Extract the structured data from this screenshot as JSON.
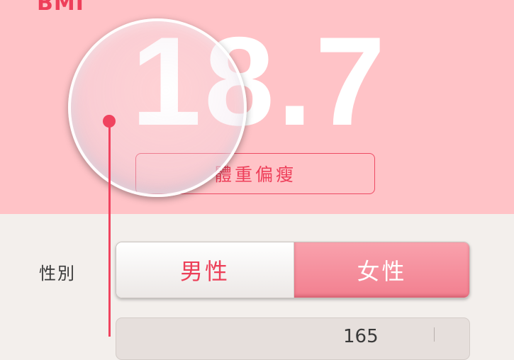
{
  "result": {
    "label": "BMI",
    "value": "18.7",
    "status": "體重偏瘦"
  },
  "form": {
    "gender_label": "性別",
    "gender_options": [
      "男性",
      "女性"
    ],
    "gender_selected": "女性",
    "height_value_partial": "165"
  },
  "colors": {
    "accent": "#ee3f5a",
    "panel_bg": "#ffc3c7",
    "selected_segment": "#f6909e"
  },
  "icons": {
    "lens": "magnifier-lens-icon"
  }
}
